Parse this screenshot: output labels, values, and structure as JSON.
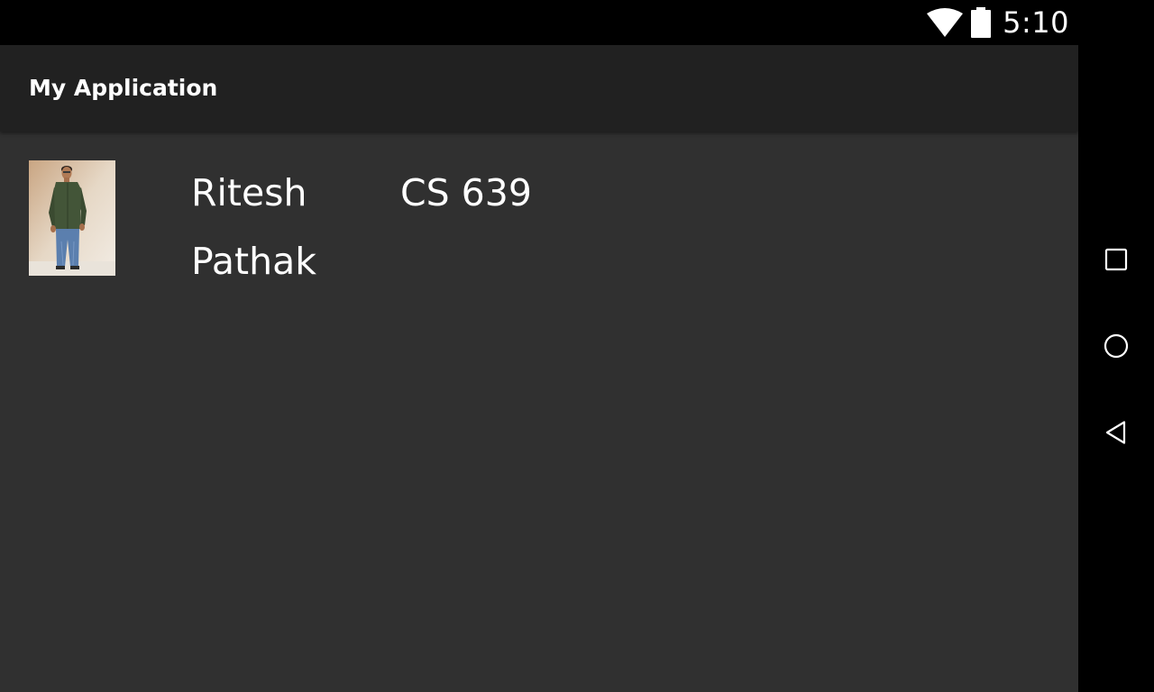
{
  "status_bar": {
    "time": "5:10",
    "icons": [
      "wifi-icon",
      "battery-icon"
    ]
  },
  "app_bar": {
    "title": "My Application"
  },
  "item": {
    "photo": "profile-photo",
    "name": "Ritesh Pathak",
    "course": "CS 639"
  },
  "nav_bar": {
    "buttons": [
      "recents-icon",
      "home-icon",
      "back-icon"
    ]
  },
  "colors": {
    "status_bar": "#000000",
    "app_bar": "#212121",
    "background": "#303030",
    "text": "#ffffff"
  }
}
